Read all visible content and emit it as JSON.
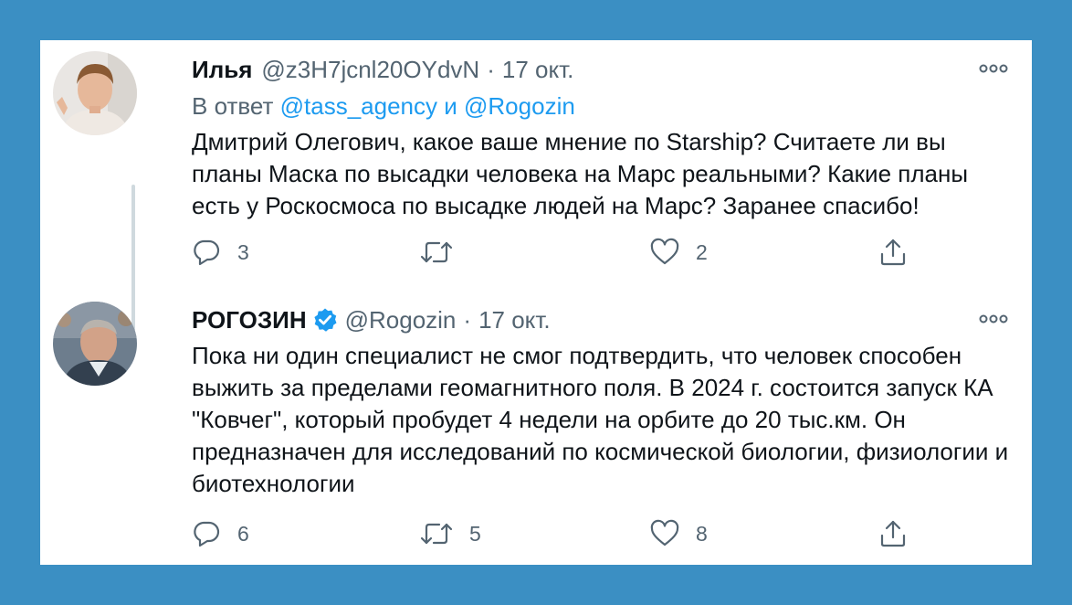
{
  "tweets": [
    {
      "author_name": "Илья",
      "handle": "@z3H7jcnl20OYdvN",
      "separator": "·",
      "date": "17 окт.",
      "reply_prefix": "В ответ",
      "reply_mention_1": "@tass_agency",
      "reply_and": "и",
      "reply_mention_2": "@Rogozin",
      "text": "Дмитрий Олегович, какое ваше мнение по Starship? Считаете ли вы планы Маска по высадки человека на Марс реальными? Какие планы есть у Роскосмоса по высадке людей на Марс? Заранее спасибо!",
      "replies": "3",
      "retweets": "",
      "likes": "2"
    },
    {
      "author_name": "РОГОЗИН",
      "handle": "@Rogozin",
      "separator": "·",
      "date": "17 окт.",
      "text": "Пока ни один специалист не смог подтвердить, что человек способен выжить за пределами геомагнитного поля. В 2024 г. состоится запуск КА \"Ковчег\", который пробудет 4 недели на орбите до 20 тыс.км. Он предназначен для исследований по космической биологии, физиологии и биотехнологии",
      "replies": "6",
      "retweets": "5",
      "likes": "8"
    }
  ],
  "icons": {
    "reply": "reply-icon",
    "retweet": "retweet-icon",
    "like": "heart-icon",
    "share": "share-icon",
    "more": "more-icon",
    "verified": "verified-badge-icon"
  },
  "colors": {
    "background": "#3b8fc3",
    "card": "#ffffff",
    "text": "#0f1419",
    "secondary": "#536471",
    "link": "#1d9bf0",
    "verified": "#1d9bf0"
  }
}
